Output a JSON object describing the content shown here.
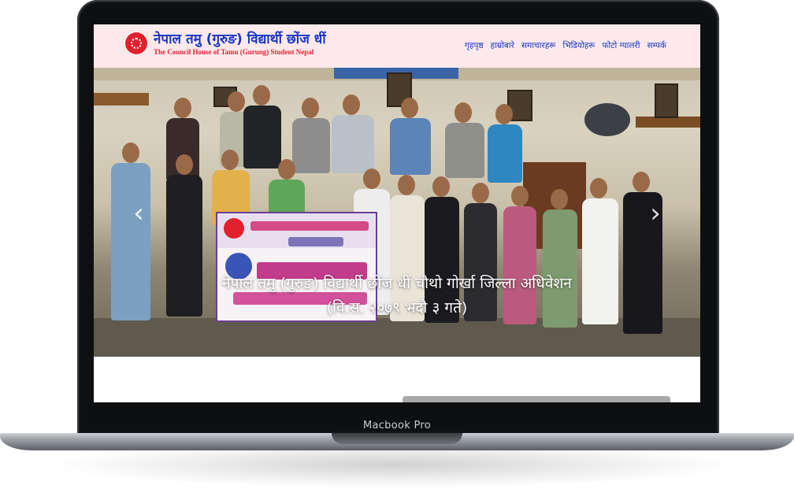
{
  "device": {
    "label": "Macbook Pro"
  },
  "site": {
    "title": "नेपाल तमु (गुरुङ) विद्यार्थी छोंज धीं",
    "subtitle": "The Council House of Tamu (Gurung) Student Nepal",
    "nav": [
      {
        "label": "गृहपृष्ठ"
      },
      {
        "label": "हाम्रोबारे"
      },
      {
        "label": "समाचारहरू"
      },
      {
        "label": "भिडियोहरू"
      },
      {
        "label": "फोटो ग्यालरी"
      },
      {
        "label": "सम्पर्क"
      }
    ]
  },
  "hero": {
    "caption_line1": "नेपाल तमु (गुरुङ) विद्यार्थी छोंज धीं चौथो गोर्खा जिल्ला अधिवेशन",
    "caption_line2": "(वि.स. २०७९ भदौ ३ गते)",
    "prev_icon": "chevron-left-icon",
    "next_icon": "chevron-right-icon"
  },
  "colors": {
    "header_bg": "#fde9ec",
    "brand_blue": "#1736c6",
    "brand_red": "#e0202e"
  }
}
